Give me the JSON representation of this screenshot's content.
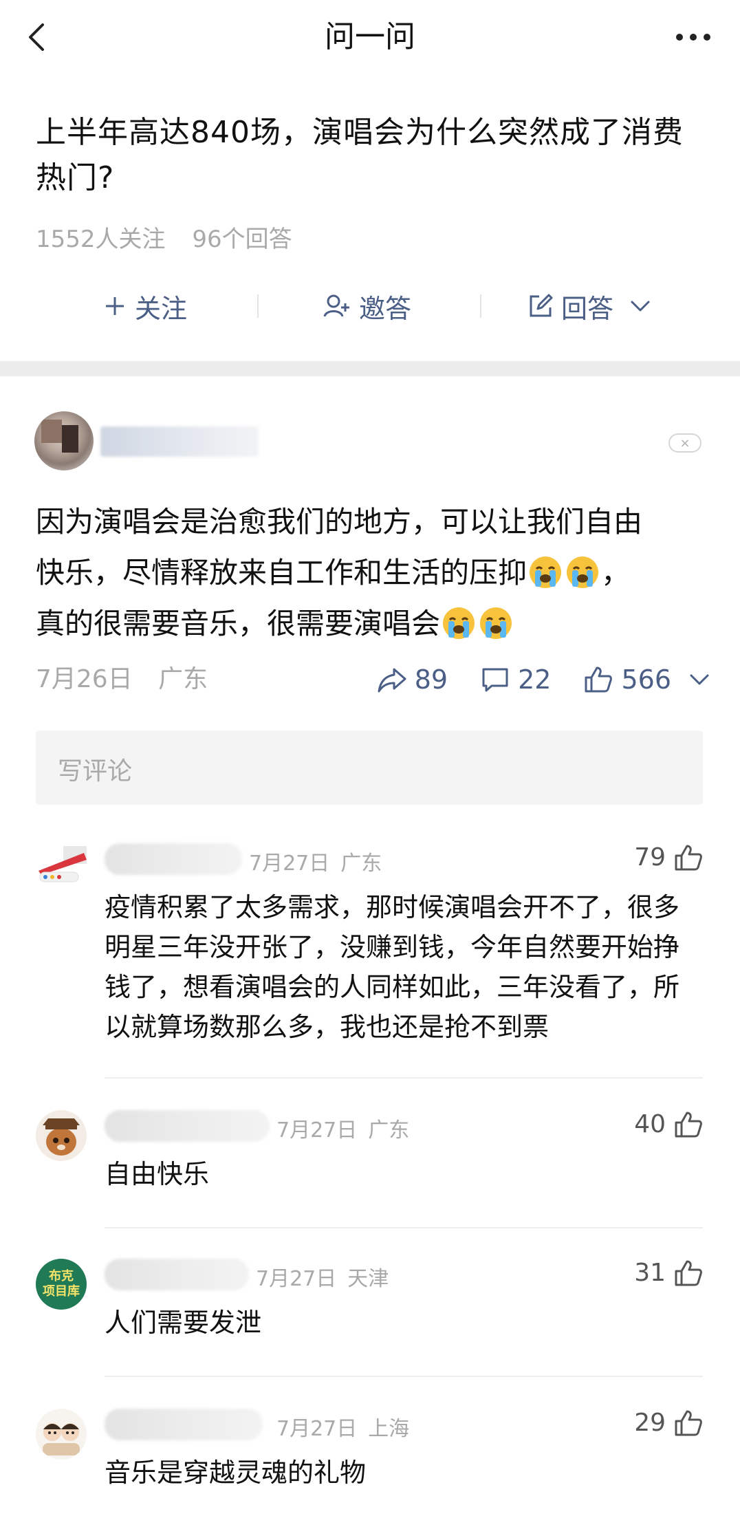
{
  "header": {
    "title": "问一问"
  },
  "question": {
    "title": "上半年高达840场，演唱会为什么突然成了消费热门?",
    "followers": "1552人关注",
    "answers": "96个回答"
  },
  "actions": {
    "follow": "关注",
    "invite": "邀答",
    "answer": "回答"
  },
  "answer": {
    "line1": "因为演唱会是治愈我们的地方，可以让我们自由",
    "line2_pre": "快乐，尽情释放来自工作和生活的压抑",
    "line2_post": "，",
    "line3": "真的很需要音乐，很需要演唱会",
    "date": "7月26日",
    "location": "广东",
    "shares": "89",
    "comments": "22",
    "likes": "566"
  },
  "comment_input": {
    "placeholder": "写评论"
  },
  "comments": [
    {
      "date": "7月27日",
      "location": "广东",
      "likes": "79",
      "text": "疫情积累了太多需求，那时候演唱会开不了，很多明星三年没开张了，没赚到钱，今年自然要开始挣钱了，想看演唱会的人同样如此，三年没看了，所以就算场数那么多，我也还是抢不到票"
    },
    {
      "date": "7月27日",
      "location": "广东",
      "likes": "40",
      "text": "自由快乐"
    },
    {
      "date": "7月27日",
      "location": "天津",
      "likes": "31",
      "text": "人们需要发泄",
      "avatar_text": "布克\n项目库"
    },
    {
      "date": "7月27日",
      "location": "上海",
      "likes": "29",
      "text": "音乐是穿越灵魂的礼物"
    }
  ]
}
